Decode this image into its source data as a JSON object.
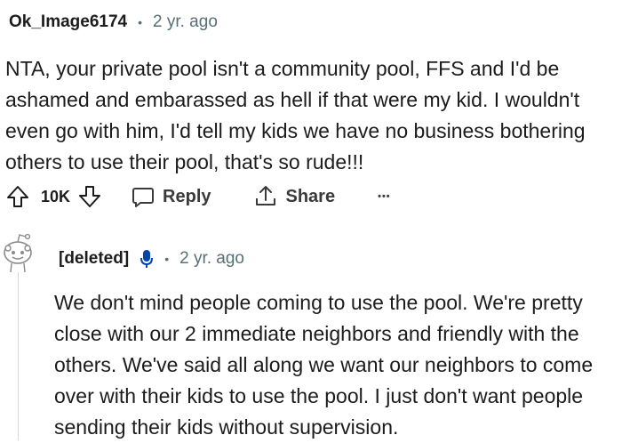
{
  "comment": {
    "username": "Ok_Image6174",
    "separator": "•",
    "timestamp": "2 yr. ago",
    "body": "NTA, your private pool isn't a community pool, FFS and I'd be ashamed and embarassed as hell if that were my kid. I wouldn't even go with him, I'd tell my kids we have no business bothering others to use their pool, that's so rude!!!",
    "votes": "10K",
    "reply_label": "Reply",
    "share_label": "Share",
    "more_label": "•••"
  },
  "reply": {
    "username": "[deleted]",
    "separator": "•",
    "timestamp": "2 yr. ago",
    "body": "We don't mind people coming to use the pool. We're pretty close with our 2 immediate neighbors and friendly with the others. We've said all along we want our neighbors to come over with their kids to use the pool. I just don't want people sending their kids without supervision."
  },
  "colors": {
    "text": "#1c1c1c",
    "meta": "#576f76",
    "mic_icon": "#0045ac"
  }
}
